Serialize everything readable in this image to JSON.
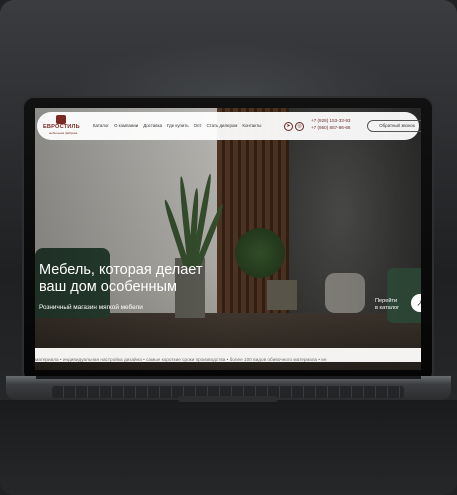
{
  "header": {
    "logo_name": "ЕВРОСТИЛЬ",
    "logo_tagline": "мебельная фабрика",
    "nav": [
      "Каталог",
      "О компании",
      "Доставка",
      "Где купить",
      "Опт",
      "Стать дилером",
      "Контакты"
    ],
    "phones": [
      "+7 (928) 153-33-93",
      "+7 (950) 857-86-66"
    ],
    "callback_label": "Обратный звонок",
    "social_icons": [
      "telegram-icon",
      "instagram-icon"
    ]
  },
  "hero": {
    "title_line1": "Мебель, которая делает",
    "title_line2": "ваш дом особенным",
    "subtitle": "Розничный магазин мягкой мебели",
    "catalog_line1": "Перейти",
    "catalog_line2": "в каталог",
    "catalog_arrow": "↗"
  },
  "ticker": {
    "text": "материала  •  индивидуальная настройка дизайна  •  самые короткие сроки производства  •  более 100 видов обивочного материала  •  ин"
  },
  "colors": {
    "brand": "#7a2a25",
    "sofa_green": "#2f4a3a"
  }
}
